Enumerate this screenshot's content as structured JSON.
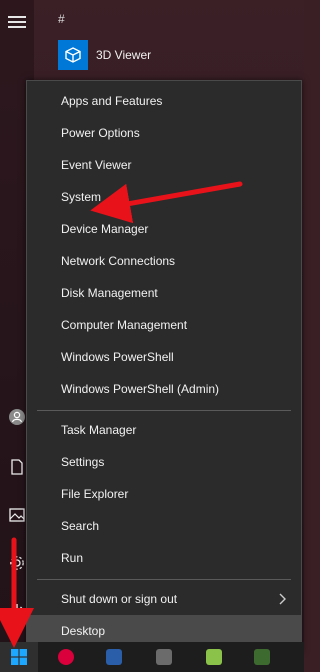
{
  "start_menu": {
    "group_header": "#",
    "apps": [
      {
        "label": "3D Viewer",
        "icon": "3d-viewer-icon"
      }
    ]
  },
  "context_menu": {
    "section1": [
      {
        "label": "Apps and Features"
      },
      {
        "label": "Power Options"
      },
      {
        "label": "Event Viewer"
      },
      {
        "label": "System"
      },
      {
        "label": "Device Manager"
      },
      {
        "label": "Network Connections"
      },
      {
        "label": "Disk Management"
      },
      {
        "label": "Computer Management"
      },
      {
        "label": "Windows PowerShell"
      },
      {
        "label": "Windows PowerShell (Admin)"
      }
    ],
    "section2": [
      {
        "label": "Task Manager"
      },
      {
        "label": "Settings"
      },
      {
        "label": "File Explorer"
      },
      {
        "label": "Search"
      },
      {
        "label": "Run"
      }
    ],
    "section3": [
      {
        "label": "Shut down or sign out",
        "has_submenu": true
      },
      {
        "label": "Desktop"
      }
    ]
  },
  "colors": {
    "accent": "#0078d7",
    "menu_bg": "#2b2b2b",
    "annotation_arrow": "#e8131a"
  }
}
